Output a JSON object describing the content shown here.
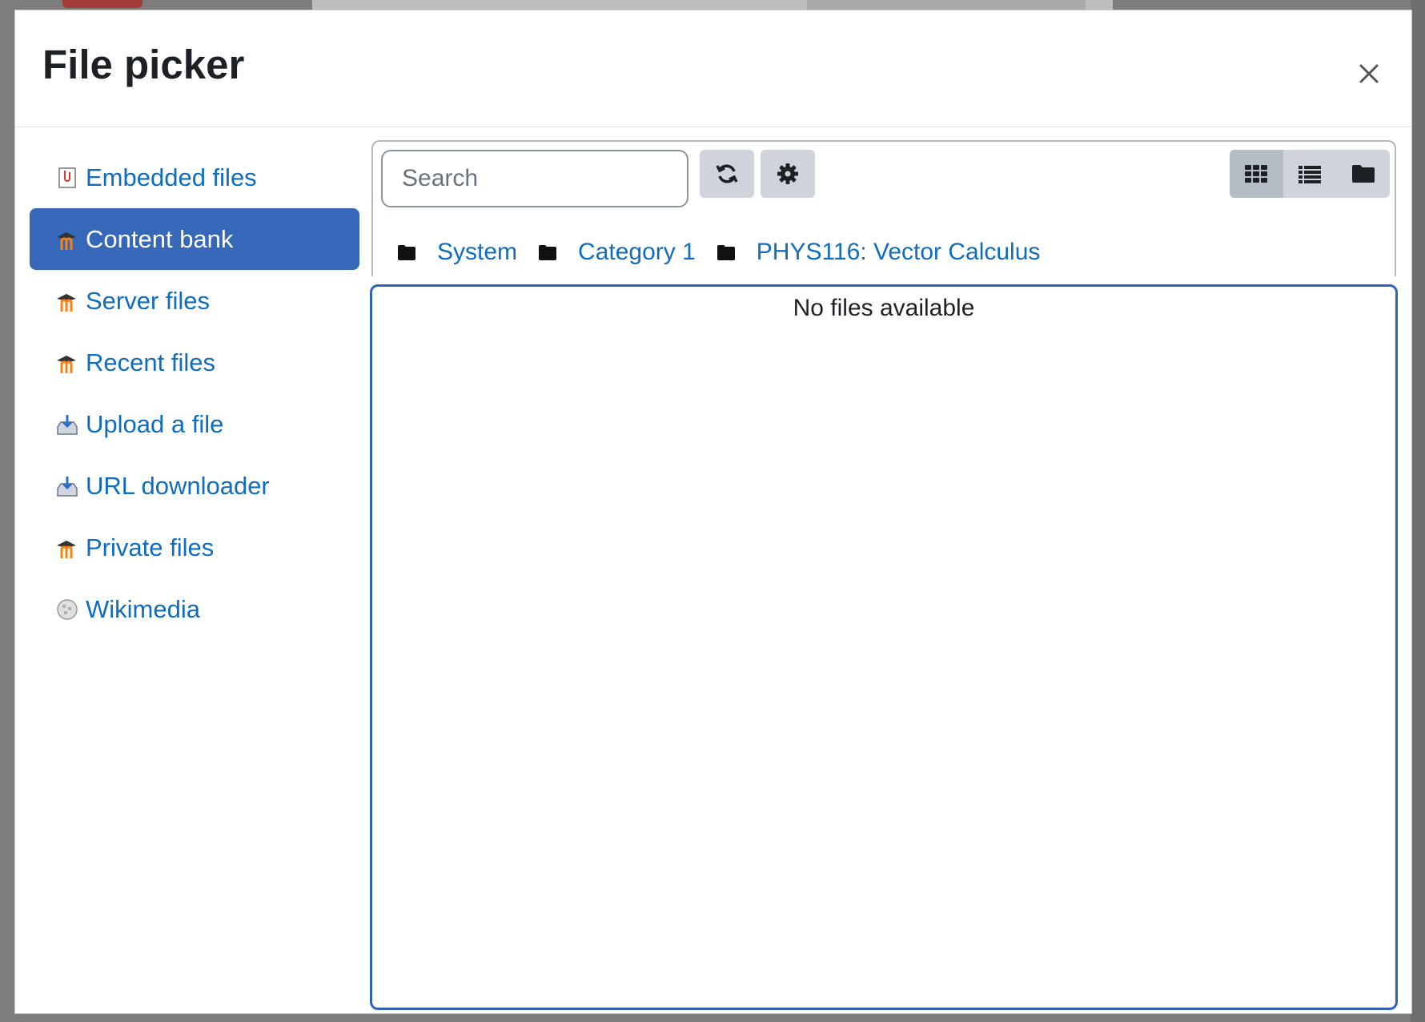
{
  "modal": {
    "title": "File picker",
    "close_label": "×"
  },
  "sidebar": {
    "items": [
      {
        "label": "Embedded files",
        "icon": "embedded-files-icon",
        "active": false
      },
      {
        "label": "Content bank",
        "icon": "moodle-icon",
        "active": true
      },
      {
        "label": "Server files",
        "icon": "moodle-icon",
        "active": false
      },
      {
        "label": "Recent files",
        "icon": "moodle-icon",
        "active": false
      },
      {
        "label": "Upload a file",
        "icon": "upload-icon",
        "active": false
      },
      {
        "label": "URL downloader",
        "icon": "upload-icon",
        "active": false
      },
      {
        "label": "Private files",
        "icon": "moodle-icon",
        "active": false
      },
      {
        "label": "Wikimedia",
        "icon": "wikimedia-globe-icon",
        "active": false
      }
    ]
  },
  "toolbar": {
    "search_placeholder": "Search",
    "refresh_icon": "refresh-icon",
    "settings_icon": "gear-icon",
    "views": [
      "grid-view-icon",
      "list-view-icon",
      "folder-view-icon"
    ],
    "active_view": "grid-view-icon"
  },
  "breadcrumb": [
    {
      "label": "System"
    },
    {
      "label": "Category 1"
    },
    {
      "label": "PHYS116: Vector Calculus"
    }
  ],
  "files": {
    "empty_message": "No files available"
  },
  "colors": {
    "link": "#0f6cbf",
    "active_bg": "#3667b9",
    "focus_border": "#2f62b8"
  }
}
